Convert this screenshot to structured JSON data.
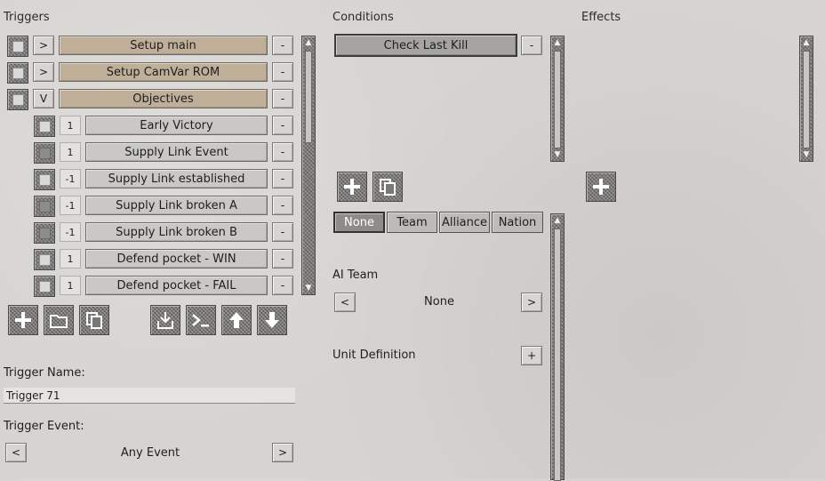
{
  "headers": {
    "triggers": "Triggers",
    "conditions": "Conditions",
    "effects": "Effects"
  },
  "triggers": [
    {
      "expand": ">",
      "label": "Setup main",
      "kind": "grp",
      "remove": "-"
    },
    {
      "expand": ">",
      "label": "Setup CamVar ROM",
      "kind": "grp",
      "remove": "-"
    },
    {
      "expand": "V",
      "label": "Objectives",
      "kind": "grp",
      "remove": "-"
    },
    {
      "expand": "1",
      "label": "Early Victory",
      "kind": "item",
      "remove": "-",
      "off": false
    },
    {
      "expand": "1",
      "label": "Supply Link Event",
      "kind": "item",
      "remove": "-",
      "off": true
    },
    {
      "expand": "-1",
      "label": "Supply Link established",
      "kind": "item",
      "remove": "-",
      "off": false
    },
    {
      "expand": "-1",
      "label": "Supply Link broken A",
      "kind": "item",
      "remove": "-",
      "off": true
    },
    {
      "expand": "-1",
      "label": "Supply Link broken B",
      "kind": "item",
      "remove": "-",
      "off": true
    },
    {
      "expand": "1",
      "label": "Defend pocket - WIN",
      "kind": "item",
      "remove": "-",
      "off": false
    },
    {
      "expand": "1",
      "label": "Defend pocket - FAIL",
      "kind": "item",
      "remove": "-",
      "off": false
    }
  ],
  "trigger_toolbar": [
    "add-icon",
    "folder-icon",
    "copy-icon",
    "import-icon",
    "console-icon",
    "move-up-icon",
    "move-down-icon"
  ],
  "trigger_name": {
    "label": "Trigger Name:",
    "value": "Trigger 71"
  },
  "trigger_event": {
    "label": "Trigger Event:",
    "value": "Any Event",
    "prev": "<",
    "next": ">"
  },
  "conditions": {
    "items": [
      {
        "label": "Check Last Kill",
        "remove": "-"
      }
    ]
  },
  "condition_toolbar": [
    "add-icon",
    "copy-icon"
  ],
  "team_tabs": [
    {
      "label": "None",
      "active": true
    },
    {
      "label": "Team"
    },
    {
      "label": "Alliance"
    },
    {
      "label": "Nation"
    }
  ],
  "ai_team": {
    "label": "AI Team",
    "value": "None",
    "prev": "<",
    "next": ">"
  },
  "unit_definition": {
    "label": "Unit Definition",
    "add": "+"
  },
  "effects_toolbar": [
    "add-icon"
  ]
}
